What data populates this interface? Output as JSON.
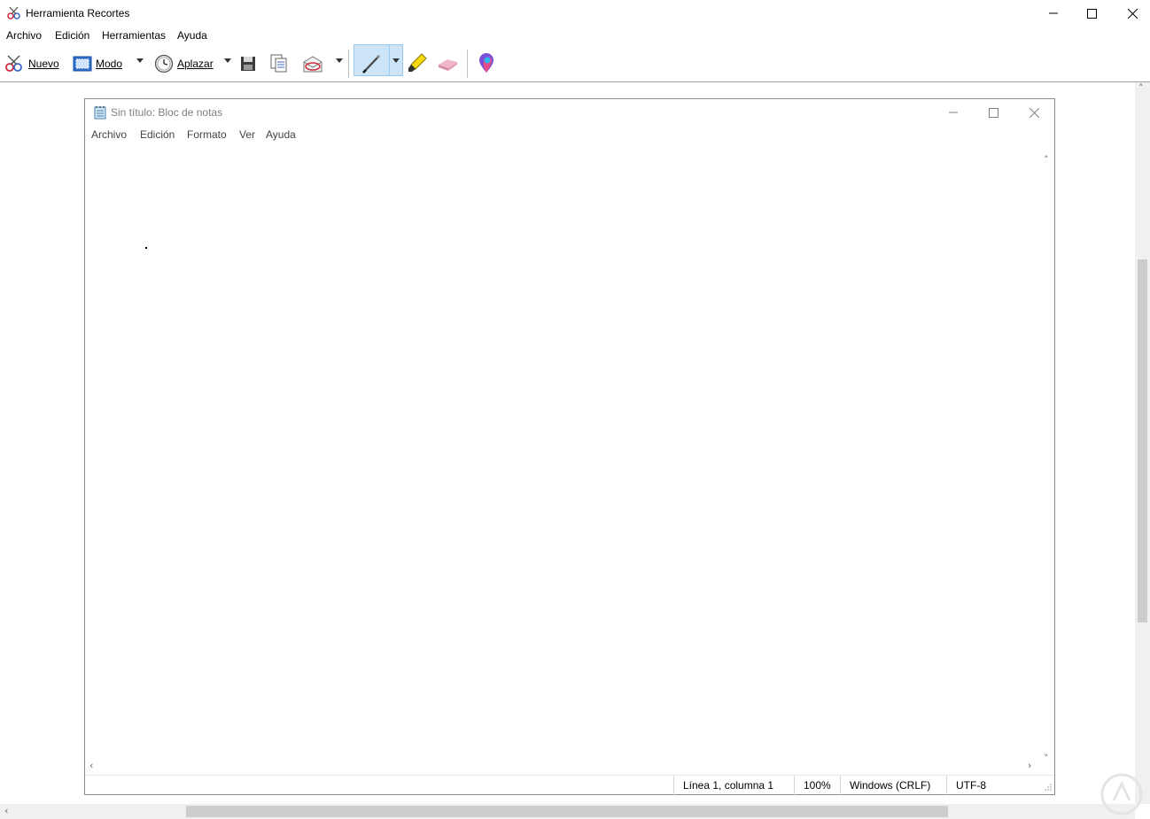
{
  "app": {
    "title": "Herramienta Recortes",
    "menu": [
      "Archivo",
      "Edición",
      "Herramientas",
      "Ayuda"
    ],
    "toolbar": {
      "nuevo": "Nuevo",
      "modo": "Modo",
      "aplazar": "Aplazar"
    },
    "icons": [
      "scissors-icon",
      "mode-rectangle-icon",
      "clock-icon",
      "save-icon",
      "copy-icon",
      "send-email-icon",
      "pen-icon",
      "highlighter-icon",
      "eraser-icon",
      "paint3d-icon"
    ],
    "active_tool": "pen"
  },
  "notepad": {
    "title": "Sin título: Bloc de notas",
    "menu": [
      "Archivo",
      "Edición",
      "Formato",
      "Ver",
      "Ayuda"
    ],
    "status": {
      "position": "Línea 1, columna 1",
      "zoom": "100%",
      "line_ending": "Windows (CRLF)",
      "encoding": "UTF-8"
    }
  },
  "colors": {
    "active_tool_bg": "#cce4f7",
    "active_tool_border": "#99c9ef",
    "scrollbar_thumb": "#cdcdcd"
  }
}
